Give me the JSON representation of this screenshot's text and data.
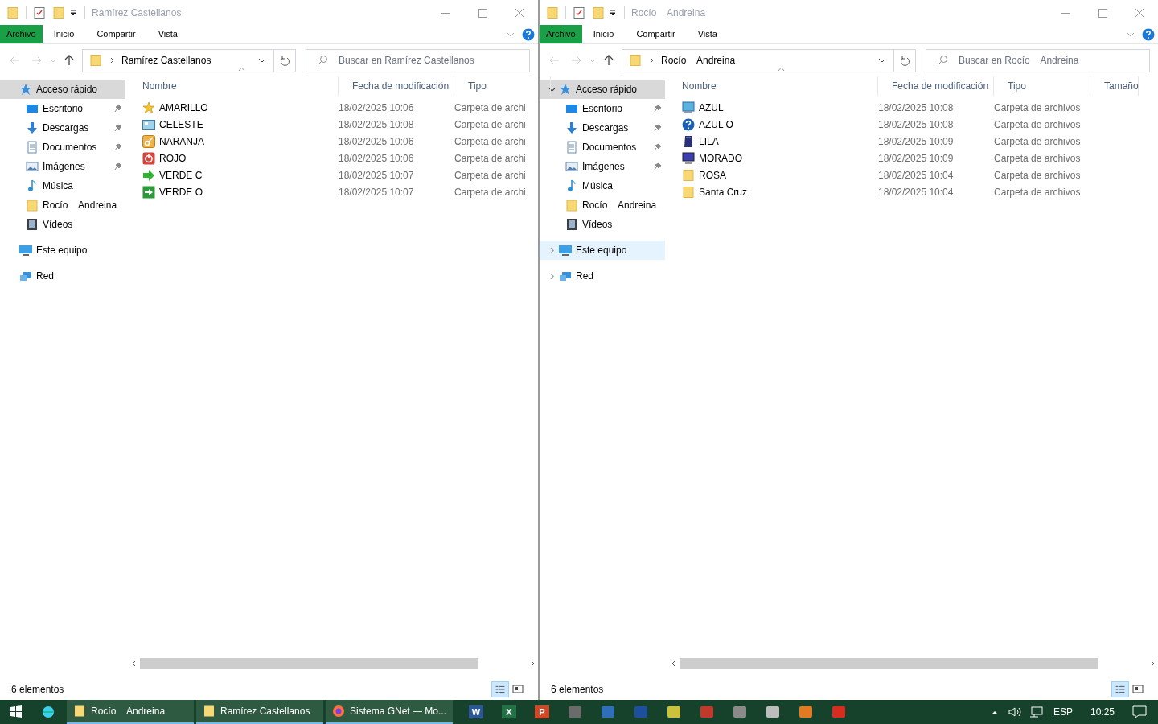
{
  "windows": [
    {
      "title": "Ramírez Castellanos",
      "ribbon_tabs": [
        {
          "label": "Archivo",
          "kind": "file"
        },
        {
          "label": "Inicio",
          "kind": "tab"
        },
        {
          "label": "Compartir",
          "kind": "tab"
        },
        {
          "label": "Vista",
          "kind": "tab"
        }
      ],
      "address": "Ramírez Castellanos",
      "search_placeholder": "Buscar en Ramírez Castellanos",
      "columns": [
        "Nombre",
        "Fecha de modificación",
        "Tipo"
      ],
      "sidebar": [
        {
          "label": "Acceso rápido",
          "kind": "quick",
          "selected": true,
          "highlighted": false,
          "pinned": false,
          "children": [
            {
              "label": "Escritorio",
              "kind": "desktop",
              "selected": false,
              "highlighted": false,
              "pinned": true
            },
            {
              "label": "Descargas",
              "kind": "download",
              "selected": false,
              "highlighted": false,
              "pinned": true
            },
            {
              "label": "Documentos",
              "kind": "document",
              "selected": false,
              "highlighted": false,
              "pinned": true
            },
            {
              "label": "Imágenes",
              "kind": "image",
              "selected": false,
              "highlighted": false,
              "pinned": true
            },
            {
              "label": "Música",
              "kind": "music",
              "selected": false,
              "highlighted": false,
              "pinned": false
            },
            {
              "label": "Rocío    Andreina",
              "kind": "folder",
              "selected": false,
              "highlighted": false,
              "pinned": false
            },
            {
              "label": "Vídeos",
              "kind": "video",
              "selected": false,
              "highlighted": false,
              "pinned": false
            }
          ]
        },
        {
          "label": "Este equipo",
          "kind": "computer",
          "selected": false,
          "highlighted": false,
          "pinned": false
        },
        {
          "label": "Red",
          "kind": "network",
          "selected": false,
          "highlighted": false,
          "pinned": false
        }
      ],
      "files": [
        {
          "name": "AMARILLO",
          "date": "18/02/2025 10:06",
          "type": "Carpeta de archi",
          "kind": "star"
        },
        {
          "name": "CELESTE",
          "date": "18/02/2025 10:08",
          "type": "Carpeta de archi",
          "kind": "card"
        },
        {
          "name": "NARANJA",
          "date": "18/02/2025 10:06",
          "type": "Carpeta de archi",
          "kind": "tile"
        },
        {
          "name": "ROJO",
          "date": "18/02/2025 10:06",
          "type": "Carpeta de archi",
          "kind": "power"
        },
        {
          "name": "VERDE C",
          "date": "18/02/2025 10:07",
          "type": "Carpeta de archi",
          "kind": "arrow"
        },
        {
          "name": "VERDE O",
          "date": "18/02/2025 10:07",
          "type": "Carpeta de archi",
          "kind": "arrowbox"
        }
      ],
      "status": "6 elementos"
    },
    {
      "title": "Rocío    Andreina",
      "ribbon_tabs": [
        {
          "label": "Archivo",
          "kind": "file"
        },
        {
          "label": "Inicio",
          "kind": "tab"
        },
        {
          "label": "Compartir",
          "kind": "tab"
        },
        {
          "label": "Vista",
          "kind": "tab"
        }
      ],
      "address": "Rocío    Andreina",
      "search_placeholder": "Buscar en Rocío    Andreina",
      "columns": [
        "Nombre",
        "Fecha de modificación",
        "Tipo",
        "Tamaño"
      ],
      "sidebar": [
        {
          "label": "Acceso rápido",
          "kind": "quick",
          "selected": true,
          "highlighted": false,
          "pinned": false,
          "expanded": true,
          "children": [
            {
              "label": "Escritorio",
              "kind": "desktop",
              "selected": false,
              "highlighted": false,
              "pinned": true
            },
            {
              "label": "Descargas",
              "kind": "download",
              "selected": false,
              "highlighted": false,
              "pinned": true
            },
            {
              "label": "Documentos",
              "kind": "document",
              "selected": false,
              "highlighted": false,
              "pinned": true
            },
            {
              "label": "Imágenes",
              "kind": "image",
              "selected": false,
              "highlighted": false,
              "pinned": true
            },
            {
              "label": "Música",
              "kind": "music",
              "selected": false,
              "highlighted": false,
              "pinned": false
            },
            {
              "label": "Rocío    Andreina",
              "kind": "folder",
              "selected": false,
              "highlighted": false,
              "pinned": false
            },
            {
              "label": "Vídeos",
              "kind": "video",
              "selected": false,
              "highlighted": false,
              "pinned": false
            }
          ]
        },
        {
          "label": "Este equipo",
          "kind": "computer",
          "selected": false,
          "highlighted": true,
          "pinned": false,
          "expanded": false
        },
        {
          "label": "Red",
          "kind": "network",
          "selected": false,
          "highlighted": false,
          "pinned": false,
          "expanded": false
        }
      ],
      "files": [
        {
          "name": "AZUL",
          "date": "18/02/2025 10:08",
          "type": "Carpeta de archivos",
          "kind": "monitor"
        },
        {
          "name": "AZUL O",
          "date": "18/02/2025 10:08",
          "type": "Carpeta de archivos",
          "kind": "help"
        },
        {
          "name": "LILA",
          "date": "18/02/2025 10:09",
          "type": "Carpeta de archivos",
          "kind": "book"
        },
        {
          "name": "MORADO",
          "date": "18/02/2025 10:09",
          "type": "Carpeta de archivos",
          "kind": "screen"
        },
        {
          "name": "ROSA",
          "date": "18/02/2025 10:04",
          "type": "Carpeta de archivos",
          "kind": "folder"
        },
        {
          "name": "Santa Cruz",
          "date": "18/02/2025 10:04",
          "type": "Carpeta de archivos",
          "kind": "folder"
        }
      ],
      "status": "6 elementos"
    }
  ],
  "taskbar": {
    "windows": [
      {
        "label": "Rocío    Andreina",
        "kind": "folder",
        "selected": false
      },
      {
        "label": "Ramírez Castellanos",
        "kind": "folder",
        "selected": false
      },
      {
        "label": "Sistema GNet — Mo...",
        "kind": "browser",
        "selected": false
      }
    ],
    "apps": [
      {
        "kind": "letter",
        "glyph": "W",
        "color": "#2b579a"
      },
      {
        "kind": "letter",
        "glyph": "X",
        "color": "#217346"
      },
      {
        "kind": "letter",
        "glyph": "P",
        "color": "#d24726"
      },
      {
        "kind": "tool",
        "color": "#6b6b6b"
      },
      {
        "kind": "tool",
        "color": "#2f6fb7"
      },
      {
        "kind": "tool",
        "color": "#1e4f9c"
      },
      {
        "kind": "tool",
        "color": "#c9c23a"
      },
      {
        "kind": "tool",
        "color": "#c0392b"
      },
      {
        "kind": "tool",
        "color": "#8a8a8a"
      },
      {
        "kind": "tool",
        "color": "#bdbdbd"
      },
      {
        "kind": "tool",
        "color": "#e07b24"
      },
      {
        "kind": "tool",
        "color": "#d62d20"
      }
    ],
    "language": "ESP",
    "time": "10:25"
  }
}
